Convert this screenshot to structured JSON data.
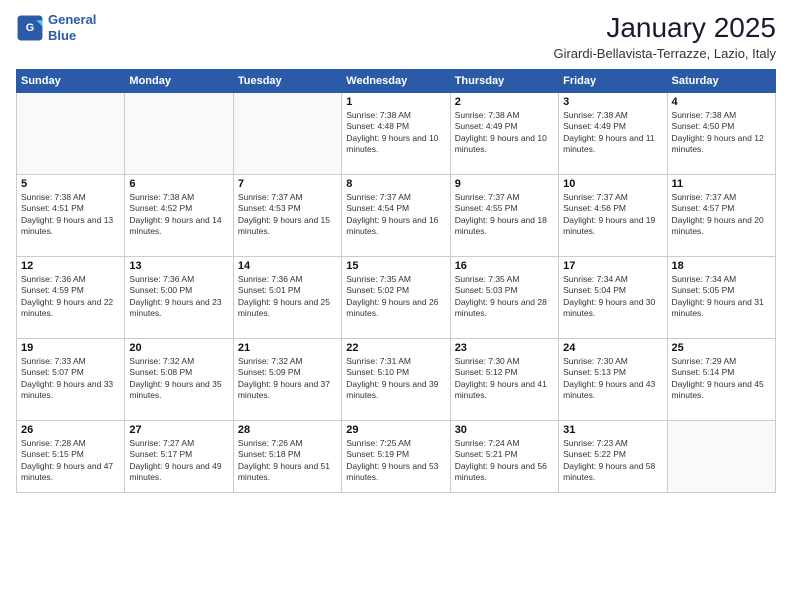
{
  "header": {
    "logo_line1": "General",
    "logo_line2": "Blue",
    "month": "January 2025",
    "location": "Girardi-Bellavista-Terrazze, Lazio, Italy"
  },
  "days_of_week": [
    "Sunday",
    "Monday",
    "Tuesday",
    "Wednesday",
    "Thursday",
    "Friday",
    "Saturday"
  ],
  "weeks": [
    [
      {
        "num": "",
        "text": ""
      },
      {
        "num": "",
        "text": ""
      },
      {
        "num": "",
        "text": ""
      },
      {
        "num": "1",
        "text": "Sunrise: 7:38 AM\nSunset: 4:48 PM\nDaylight: 9 hours and 10 minutes."
      },
      {
        "num": "2",
        "text": "Sunrise: 7:38 AM\nSunset: 4:49 PM\nDaylight: 9 hours and 10 minutes."
      },
      {
        "num": "3",
        "text": "Sunrise: 7:38 AM\nSunset: 4:49 PM\nDaylight: 9 hours and 11 minutes."
      },
      {
        "num": "4",
        "text": "Sunrise: 7:38 AM\nSunset: 4:50 PM\nDaylight: 9 hours and 12 minutes."
      }
    ],
    [
      {
        "num": "5",
        "text": "Sunrise: 7:38 AM\nSunset: 4:51 PM\nDaylight: 9 hours and 13 minutes."
      },
      {
        "num": "6",
        "text": "Sunrise: 7:38 AM\nSunset: 4:52 PM\nDaylight: 9 hours and 14 minutes."
      },
      {
        "num": "7",
        "text": "Sunrise: 7:37 AM\nSunset: 4:53 PM\nDaylight: 9 hours and 15 minutes."
      },
      {
        "num": "8",
        "text": "Sunrise: 7:37 AM\nSunset: 4:54 PM\nDaylight: 9 hours and 16 minutes."
      },
      {
        "num": "9",
        "text": "Sunrise: 7:37 AM\nSunset: 4:55 PM\nDaylight: 9 hours and 18 minutes."
      },
      {
        "num": "10",
        "text": "Sunrise: 7:37 AM\nSunset: 4:56 PM\nDaylight: 9 hours and 19 minutes."
      },
      {
        "num": "11",
        "text": "Sunrise: 7:37 AM\nSunset: 4:57 PM\nDaylight: 9 hours and 20 minutes."
      }
    ],
    [
      {
        "num": "12",
        "text": "Sunrise: 7:36 AM\nSunset: 4:59 PM\nDaylight: 9 hours and 22 minutes."
      },
      {
        "num": "13",
        "text": "Sunrise: 7:36 AM\nSunset: 5:00 PM\nDaylight: 9 hours and 23 minutes."
      },
      {
        "num": "14",
        "text": "Sunrise: 7:36 AM\nSunset: 5:01 PM\nDaylight: 9 hours and 25 minutes."
      },
      {
        "num": "15",
        "text": "Sunrise: 7:35 AM\nSunset: 5:02 PM\nDaylight: 9 hours and 26 minutes."
      },
      {
        "num": "16",
        "text": "Sunrise: 7:35 AM\nSunset: 5:03 PM\nDaylight: 9 hours and 28 minutes."
      },
      {
        "num": "17",
        "text": "Sunrise: 7:34 AM\nSunset: 5:04 PM\nDaylight: 9 hours and 30 minutes."
      },
      {
        "num": "18",
        "text": "Sunrise: 7:34 AM\nSunset: 5:05 PM\nDaylight: 9 hours and 31 minutes."
      }
    ],
    [
      {
        "num": "19",
        "text": "Sunrise: 7:33 AM\nSunset: 5:07 PM\nDaylight: 9 hours and 33 minutes."
      },
      {
        "num": "20",
        "text": "Sunrise: 7:32 AM\nSunset: 5:08 PM\nDaylight: 9 hours and 35 minutes."
      },
      {
        "num": "21",
        "text": "Sunrise: 7:32 AM\nSunset: 5:09 PM\nDaylight: 9 hours and 37 minutes."
      },
      {
        "num": "22",
        "text": "Sunrise: 7:31 AM\nSunset: 5:10 PM\nDaylight: 9 hours and 39 minutes."
      },
      {
        "num": "23",
        "text": "Sunrise: 7:30 AM\nSunset: 5:12 PM\nDaylight: 9 hours and 41 minutes."
      },
      {
        "num": "24",
        "text": "Sunrise: 7:30 AM\nSunset: 5:13 PM\nDaylight: 9 hours and 43 minutes."
      },
      {
        "num": "25",
        "text": "Sunrise: 7:29 AM\nSunset: 5:14 PM\nDaylight: 9 hours and 45 minutes."
      }
    ],
    [
      {
        "num": "26",
        "text": "Sunrise: 7:28 AM\nSunset: 5:15 PM\nDaylight: 9 hours and 47 minutes."
      },
      {
        "num": "27",
        "text": "Sunrise: 7:27 AM\nSunset: 5:17 PM\nDaylight: 9 hours and 49 minutes."
      },
      {
        "num": "28",
        "text": "Sunrise: 7:26 AM\nSunset: 5:18 PM\nDaylight: 9 hours and 51 minutes."
      },
      {
        "num": "29",
        "text": "Sunrise: 7:25 AM\nSunset: 5:19 PM\nDaylight: 9 hours and 53 minutes."
      },
      {
        "num": "30",
        "text": "Sunrise: 7:24 AM\nSunset: 5:21 PM\nDaylight: 9 hours and 56 minutes."
      },
      {
        "num": "31",
        "text": "Sunrise: 7:23 AM\nSunset: 5:22 PM\nDaylight: 9 hours and 58 minutes."
      },
      {
        "num": "",
        "text": ""
      }
    ]
  ]
}
